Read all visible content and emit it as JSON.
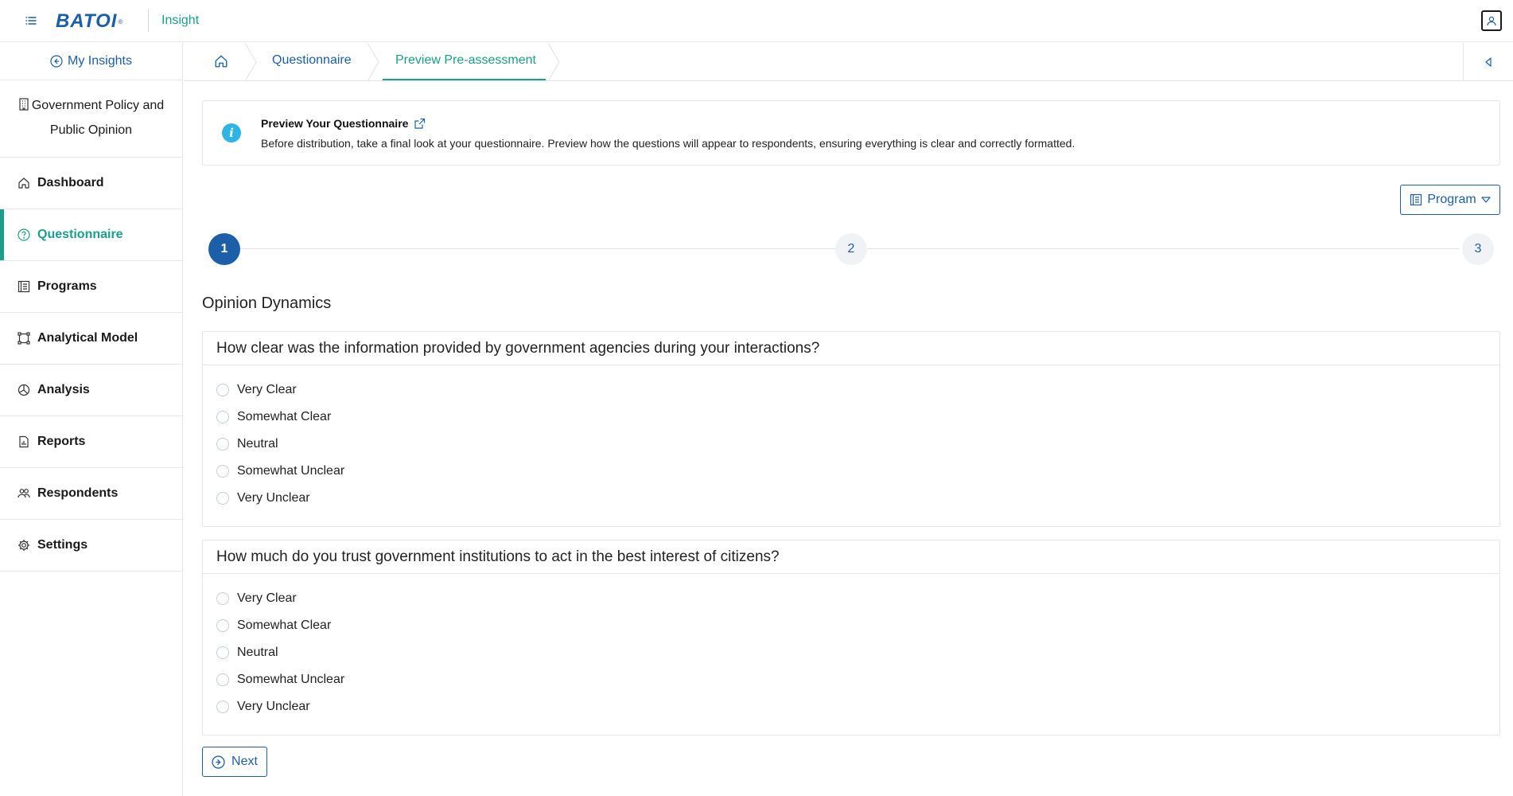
{
  "header": {
    "logo_text": "BATOI",
    "logo_reg": "®",
    "app_name": "Insight",
    "menu_icon": "menu-icon",
    "user_icon": "user-icon"
  },
  "sidebar": {
    "back_label": "My Insights",
    "project_title": "Government Policy and Public Opinion",
    "items": [
      {
        "label": "Dashboard",
        "icon": "home-icon",
        "active": false
      },
      {
        "label": "Questionnaire",
        "icon": "question-circle-icon",
        "active": true
      },
      {
        "label": "Programs",
        "icon": "list-icon",
        "active": false
      },
      {
        "label": "Analytical Model",
        "icon": "model-icon",
        "active": false
      },
      {
        "label": "Analysis",
        "icon": "pie-chart-icon",
        "active": false
      },
      {
        "label": "Reports",
        "icon": "report-icon",
        "active": false
      },
      {
        "label": "Respondents",
        "icon": "users-icon",
        "active": false
      },
      {
        "label": "Settings",
        "icon": "gear-icon",
        "active": false
      }
    ]
  },
  "breadcrumb": {
    "items": [
      "Questionnaire",
      "Preview Pre-assessment"
    ]
  },
  "info": {
    "title": "Preview Your Questionnaire",
    "description": "Before distribution, take a final look at your questionnaire. Preview how the questions will appear to respondents, ensuring everything is clear and correctly formatted."
  },
  "program_button": "Program",
  "stepper": {
    "steps": [
      "1",
      "2",
      "3"
    ],
    "current": 1
  },
  "section_title": "Opinion Dynamics",
  "questions": [
    {
      "text": "How clear was the information provided by government agencies during your interactions?",
      "options": [
        "Very Clear",
        "Somewhat Clear",
        "Neutral",
        "Somewhat Unclear",
        "Very Unclear"
      ]
    },
    {
      "text": "How much do you trust government institutions to act in the best interest of citizens?",
      "options": [
        "Very Clear",
        "Somewhat Clear",
        "Neutral",
        "Somewhat Unclear",
        "Very Unclear"
      ]
    }
  ],
  "next_button": "Next",
  "colors": {
    "brand_blue": "#1c5fa8",
    "accent_teal": "#1aa08a",
    "info_blue": "#2fb4e6"
  }
}
